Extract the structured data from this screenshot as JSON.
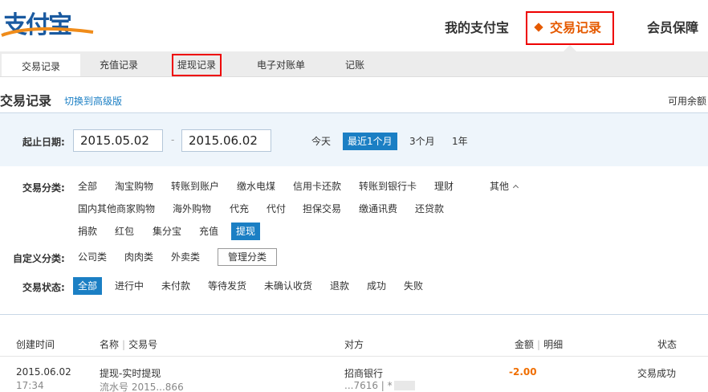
{
  "header": {
    "logo_text": "支付宝",
    "nav": [
      {
        "label": "我的支付宝"
      },
      {
        "label": "交易记录"
      },
      {
        "label": "会员保障"
      }
    ]
  },
  "subnav": [
    {
      "label": "交易记录"
    },
    {
      "label": "充值记录"
    },
    {
      "label": "提现记录"
    },
    {
      "label": "电子对账单"
    },
    {
      "label": "记账"
    }
  ],
  "page": {
    "title": "交易记录",
    "switch_link": "切换到高级版",
    "balance_label": "可用余额"
  },
  "filters": {
    "date_label": "起止日期:",
    "start_date": "2015.05.02",
    "end_date": "2015.06.02",
    "date_sep": "-",
    "periods": [
      "今天",
      "最近1个月",
      "3个月",
      "1年"
    ],
    "category_label": "交易分类:",
    "categories_row1": [
      "全部",
      "淘宝购物",
      "转账到账户",
      "缴水电煤",
      "信用卡还款",
      "转账到银行卡",
      "理财",
      "其他"
    ],
    "categories_row2": [
      "国内其他商家购物",
      "海外购物",
      "代充",
      "代付",
      "担保交易",
      "缴通讯费",
      "还贷款"
    ],
    "categories_row3": [
      "捐款",
      "红包",
      "集分宝",
      "充值",
      "提现"
    ],
    "custom_label": "自定义分类:",
    "custom": [
      "公司类",
      "肉肉类",
      "外卖类"
    ],
    "manage_button": "管理分类",
    "status_label": "交易状态:",
    "statuses": [
      "全部",
      "进行中",
      "未付款",
      "等待发货",
      "未确认收货",
      "退款",
      "成功",
      "失败"
    ]
  },
  "table": {
    "headers": {
      "time": "创建时间",
      "name": "名称",
      "trade_no": "交易号",
      "counterparty": "对方",
      "amount": "金额",
      "detail": "明细",
      "status": "状态"
    },
    "rows": [
      {
        "date": "2015.06.02",
        "time": "17:34",
        "name": "提现-实时提现",
        "serial": "流水号 2015...866",
        "counterparty": "招商银行",
        "account": "...7616 | *",
        "amount": "-2.00",
        "status": "交易成功"
      }
    ]
  },
  "colors": {
    "accent_blue": "#1b7fc4",
    "accent_orange": "#e55a00",
    "highlight_red": "#e00000"
  }
}
